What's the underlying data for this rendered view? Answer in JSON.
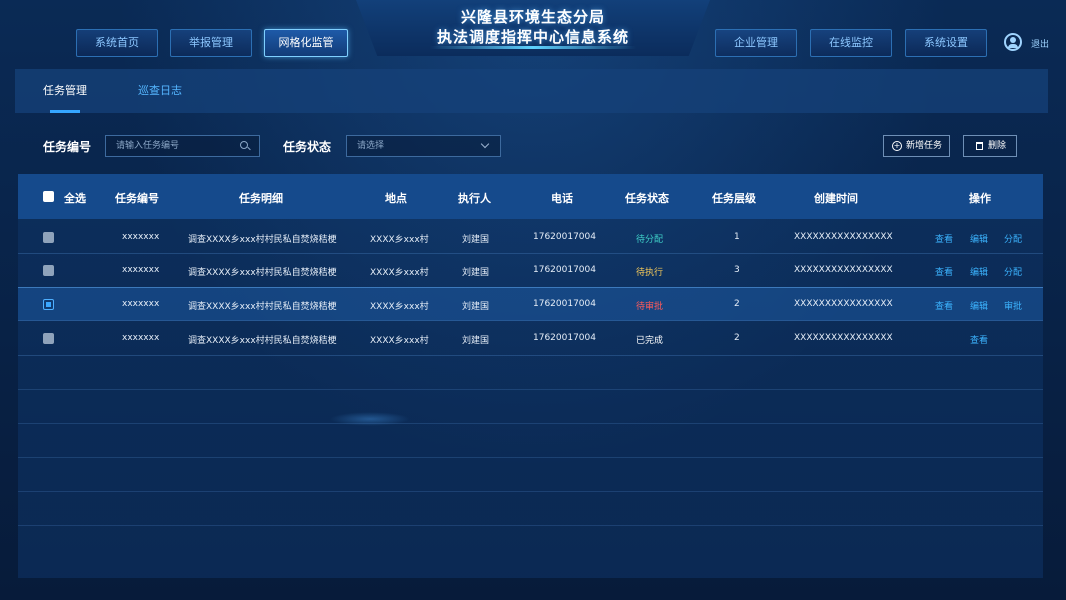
{
  "header": {
    "title_line1": "兴隆县环境生态分局",
    "title_line2": "执法调度指挥中心信息系统",
    "nav_left": [
      "系统首页",
      "举报管理",
      "网格化监管"
    ],
    "nav_right": [
      "企业管理",
      "在线监控",
      "系统设置"
    ],
    "active_nav": "网格化监管",
    "logout": "退出"
  },
  "tabs": [
    "任务管理",
    "巡查日志"
  ],
  "filters": {
    "task_no_label": "任务编号",
    "task_no_placeholder": "请输入任务编号",
    "status_label": "任务状态",
    "status_placeholder": "请选择",
    "add_button": "新增任务",
    "delete_button": "删除"
  },
  "table": {
    "select_all": "全选",
    "headers": [
      "任务编号",
      "任务明细",
      "地点",
      "执行人",
      "电话",
      "任务状态",
      "任务层级",
      "创建时间",
      "操作"
    ],
    "rows": [
      {
        "no": "xxxxxxx",
        "detail": "调查XXXX乡xxx村村民私自焚烧秸梗",
        "place": "XXXX乡xxx村",
        "executor": "刘建国",
        "phone": "17620017004",
        "status": "待分配",
        "level": "1",
        "created": "XXXXXXXXXXXXXXXX",
        "ops": [
          "查看",
          "编辑",
          "分配"
        ]
      },
      {
        "no": "xxxxxxx",
        "detail": "调查XXXX乡xxx村村民私自焚烧秸梗",
        "place": "XXXX乡xxx村",
        "executor": "刘建国",
        "phone": "17620017004",
        "status": "待执行",
        "level": "3",
        "created": "XXXXXXXXXXXXXXXX",
        "ops": [
          "查看",
          "编辑",
          "分配"
        ]
      },
      {
        "no": "xxxxxxx",
        "detail": "调查XXXX乡xxx村村民私自焚烧秸梗",
        "place": "XXXX乡xxx村",
        "executor": "刘建国",
        "phone": "17620017004",
        "status": "待审批",
        "level": "2",
        "created": "XXXXXXXXXXXXXXXX",
        "ops": [
          "查看",
          "编辑",
          "审批"
        ]
      },
      {
        "no": "xxxxxxx",
        "detail": "调查XXXX乡xxx村村民私自焚烧秸梗",
        "place": "XXXX乡xxx村",
        "executor": "刘建国",
        "phone": "17620017004",
        "status": "已完成",
        "level": "2",
        "created": "XXXXXXXXXXXXXXXX",
        "ops": [
          "查看"
        ]
      }
    ]
  },
  "colors": {
    "status_pending_assign": "#3fd0c8",
    "status_pending_exec": "#f5c95a",
    "status_pending_approve": "#ff5a5a",
    "status_done": "#ffffff",
    "link": "#3cb4ff"
  }
}
